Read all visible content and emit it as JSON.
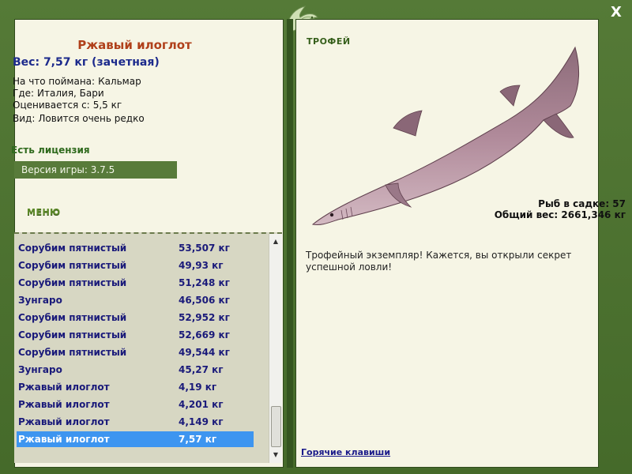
{
  "window": {
    "close_label": "X"
  },
  "fish": {
    "name": "Ржавый илоглот",
    "weight_line": "Вес: 7,57 кг (зачетная)",
    "bait_label": "На что поймана:",
    "bait_value": "Кальмар",
    "where_label": "Где:",
    "where_value": "Италия, Бари",
    "valued_label": "Оценивается с:",
    "valued_value": "5,5 кг",
    "kind_label": "Вид:",
    "kind_value": "Ловится очень редко"
  },
  "license_label": "Есть лицензия",
  "version_label": "Версия игры: 3.7.5",
  "menu_label": "МЕНЮ",
  "stats": {
    "keepnet": "Рыб в садке: 57",
    "total_weight": "Общий вес: 2661,346 кг"
  },
  "catches": [
    {
      "name": "Сорубим пятнистый",
      "weight": "53,507 кг"
    },
    {
      "name": "Сорубим пятнистый",
      "weight": "49,93 кг"
    },
    {
      "name": "Сорубим пятнистый",
      "weight": "51,248 кг"
    },
    {
      "name": "Зунгаро",
      "weight": "46,506 кг"
    },
    {
      "name": "Сорубим пятнистый",
      "weight": "52,952 кг"
    },
    {
      "name": "Сорубим пятнистый",
      "weight": "52,669 кг"
    },
    {
      "name": "Сорубим пятнистый",
      "weight": "49,544 кг"
    },
    {
      "name": "Зунгаро",
      "weight": "45,27 кг"
    },
    {
      "name": "Ржавый илоглот",
      "weight": "4,19 кг"
    },
    {
      "name": "Ржавый илоглот",
      "weight": "4,201 кг"
    },
    {
      "name": "Ржавый илоглот",
      "weight": "4,149 кг"
    },
    {
      "name": "Ржавый илоглот",
      "weight": "7,57 кг",
      "selected": true
    }
  ],
  "trophy": {
    "title": "ТРОФЕЙ",
    "text": "Трофейный экземпляр! Кажется, вы открыли секрет успешной ловли!"
  },
  "hotkeys_label": "Горячие клавиши",
  "icons": {
    "logo": "fish-logo-icon",
    "scroll_up": "scroll-up-arrow-icon",
    "scroll_down": "scroll-down-arrow-icon",
    "close": "close-icon"
  },
  "colors": {
    "frame": "#4c6e31",
    "panel": "#f6f5e5",
    "fish_name": "#b0401a",
    "weight": "#1c2a8c",
    "selection": "#3d95f0"
  }
}
